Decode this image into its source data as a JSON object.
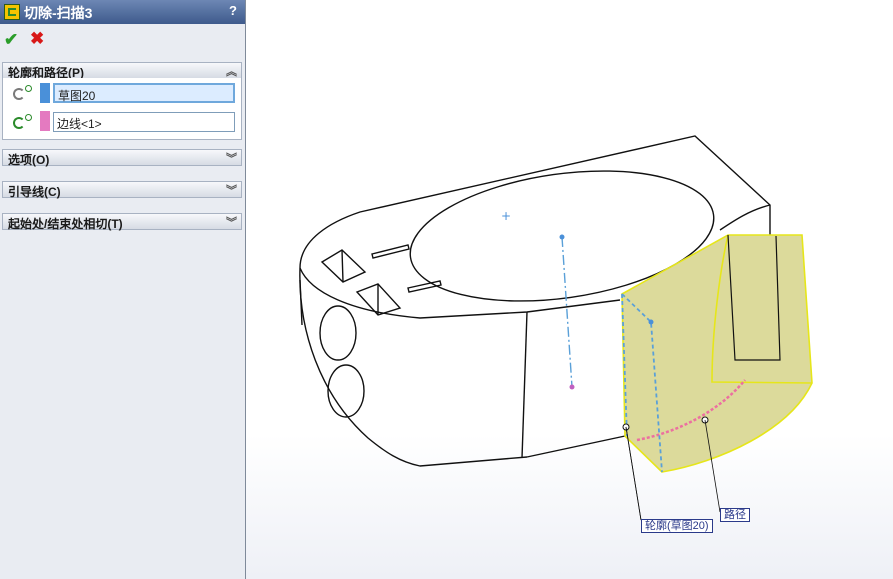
{
  "property_manager": {
    "title": "切除-扫描3",
    "help": "?",
    "ok_symbol": "✔",
    "cancel_symbol": "✖",
    "groups": {
      "profile_path": {
        "label": "轮廓和路径(P)",
        "profile_field": "草图20",
        "path_field": "边线<1>",
        "profile_color": "#4a90d9",
        "path_color": "#e47ac0"
      },
      "options": {
        "label": "选项(O)"
      },
      "guide_curves": {
        "label": "引导线(C)"
      },
      "start_end_tangency": {
        "label": "起始处/结束处相切(T)"
      }
    }
  },
  "viewport": {
    "callouts": {
      "profile": "轮廓(草图20)",
      "path": "路径"
    },
    "colors": {
      "sweep_fill": "#d6d48a",
      "sweep_edge": "#e6e61a",
      "profile_line": "#5aa0d8",
      "path_line": "#ec6fa0"
    }
  }
}
